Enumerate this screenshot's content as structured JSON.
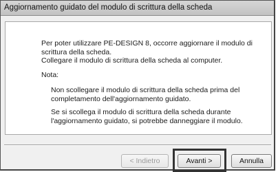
{
  "window": {
    "title": "Aggiornamento guidato del modulo di scrittura della scheda"
  },
  "content": {
    "intro": "Per poter utilizzare PE-DESIGN 8, occorre aggiornare il modulo di scrittura della scheda.\nCollegare il modulo di scrittura della scheda al computer.",
    "note_label": "Nota:",
    "warning_1": "Non scollegare il modulo di scrittura della scheda prima del completamento dell'aggiornamento guidato.",
    "warning_2": "Se si scollega il modulo di scrittura della scheda durante l'aggiornamento guidato, si potrebbe danneggiare il modulo."
  },
  "buttons": {
    "back_label": "< Indietro",
    "back_enabled": false,
    "next_label": "Avanti >",
    "cancel_label": "Annulla"
  },
  "colors": {
    "highlight_border": "#333333",
    "disabled_text": "#9a9a9a"
  }
}
